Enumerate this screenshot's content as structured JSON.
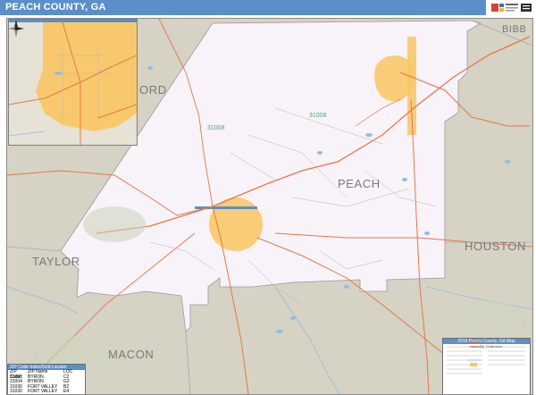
{
  "header": {
    "title": "PEACH COUNTY, GA",
    "logo_text": "Market Maps"
  },
  "map_labels": {
    "county_peach": "PEACH",
    "county_houston": "HOUSTON",
    "county_taylor": "TAYLOR",
    "county_macon": "MACON",
    "county_bibb": "BIBB",
    "county_crawford_partial": "ORD",
    "zip_31008": "31008",
    "zip_31008_inset": "31008"
  },
  "zip_table": {
    "title": "ZIP Code Index/Grid Locator",
    "headers": [
      "ZIP Code",
      "ZIP Name",
      "LOC"
    ],
    "rows": [
      [
        "31008",
        "BYRON",
        "C2"
      ],
      [
        "31004",
        "BYRON",
        "G2"
      ],
      [
        "31030",
        "FORT VALLEY",
        "B2"
      ],
      [
        "31030",
        "FORT VALLEY",
        "E4"
      ]
    ]
  },
  "legend": {
    "title": "2016 Peach County, GA Map",
    "subtitle": "www.Zip-Code.com"
  },
  "colors": {
    "header_blue": "#5b8fc9",
    "county_fill": "#f8f2f9",
    "surrounding_fill": "#d6d2c4",
    "city_highlight": "#f9c661",
    "road_orange": "#e07a4a",
    "water_blue": "#8fbde6",
    "highway_green": "#5aa46e"
  }
}
